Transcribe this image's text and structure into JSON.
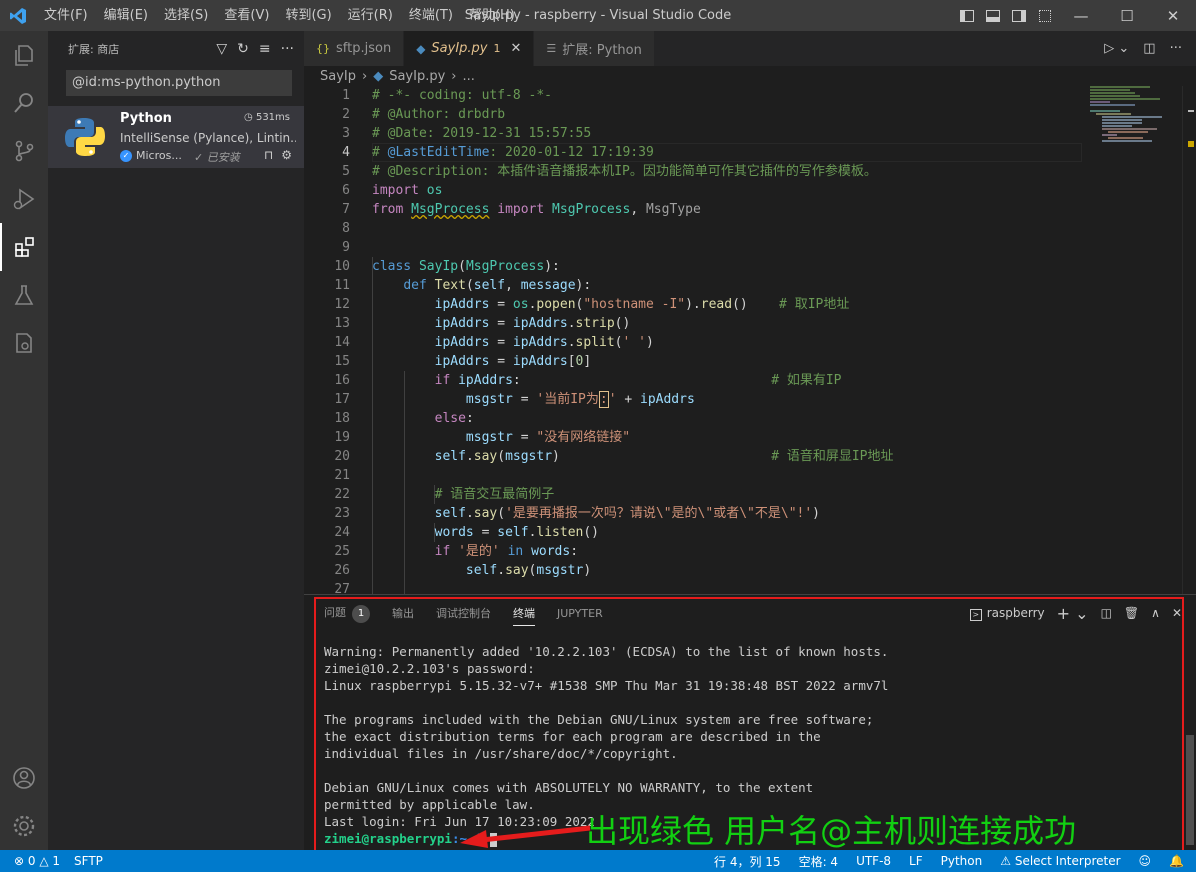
{
  "titlebar": {
    "menus": [
      "文件(F)",
      "编辑(E)",
      "选择(S)",
      "查看(V)",
      "转到(G)",
      "运行(R)",
      "终端(T)",
      "帮助(H)"
    ],
    "title": "SayIp.py - raspberry - Visual Studio Code"
  },
  "sidebar": {
    "title": "扩展: 商店",
    "search_value": "@id:ms-python.python",
    "extension": {
      "name": "Python",
      "time": "531ms",
      "description": "IntelliSense (Pylance), Lintin...",
      "publisher": "Micros...",
      "status": "已安装"
    }
  },
  "tabs": [
    {
      "icon": "{}",
      "label": "sftp.json"
    },
    {
      "icon": "py",
      "label": "SayIp.py",
      "modified": "1"
    },
    {
      "icon": "ext",
      "label": "扩展: Python"
    }
  ],
  "breadcrumb": {
    "folder": "SayIp",
    "file": "SayIp.py",
    "more": "..."
  },
  "editor": {
    "line_numbers": [
      "1",
      "2",
      "3",
      "4",
      "5",
      "6",
      "7",
      "8",
      "9",
      "10",
      "11",
      "12",
      "13",
      "14",
      "15",
      "16",
      "17",
      "18",
      "19",
      "20",
      "21",
      "22",
      "23",
      "24",
      "25",
      "26",
      "27"
    ],
    "current_line": "4"
  },
  "panel": {
    "tabs": [
      "问题",
      "输出",
      "调试控制台",
      "终端",
      "JUPYTER"
    ],
    "problems_count": "1",
    "terminal_name": "raspberry",
    "lines": [
      "Warning: Permanently added '10.2.2.103' (ECDSA) to the list of known hosts.",
      "zimei@10.2.2.103's password:",
      "Linux raspberrypi 5.15.32-v7+ #1538 SMP Thu Mar 31 19:38:48 BST 2022 armv7l",
      "",
      "The programs included with the Debian GNU/Linux system are free software;",
      "the exact distribution terms for each program are described in the",
      "individual files in /usr/share/doc/*/copyright.",
      "",
      "Debian GNU/Linux comes with ABSOLUTELY NO WARRANTY, to the extent",
      "permitted by applicable law.",
      "Last login: Fri Jun 17 10:23:09 2022"
    ],
    "prompt_user": "zimei@raspberrypi",
    "prompt_path": ":~ $"
  },
  "annotation": "出现绿色 用户名@主机则连接成功",
  "statusbar": {
    "errors": "0",
    "warnings": "1",
    "sftp": "SFTP",
    "position": "行 4，列 15",
    "spaces": "空格: 4",
    "encoding": "UTF-8",
    "eol": "LF",
    "language": "Python",
    "interpreter": "Select Interpreter"
  },
  "colors": {
    "accent": "#007acc",
    "annotation": "#12d012",
    "frame": "#e51c1c"
  }
}
